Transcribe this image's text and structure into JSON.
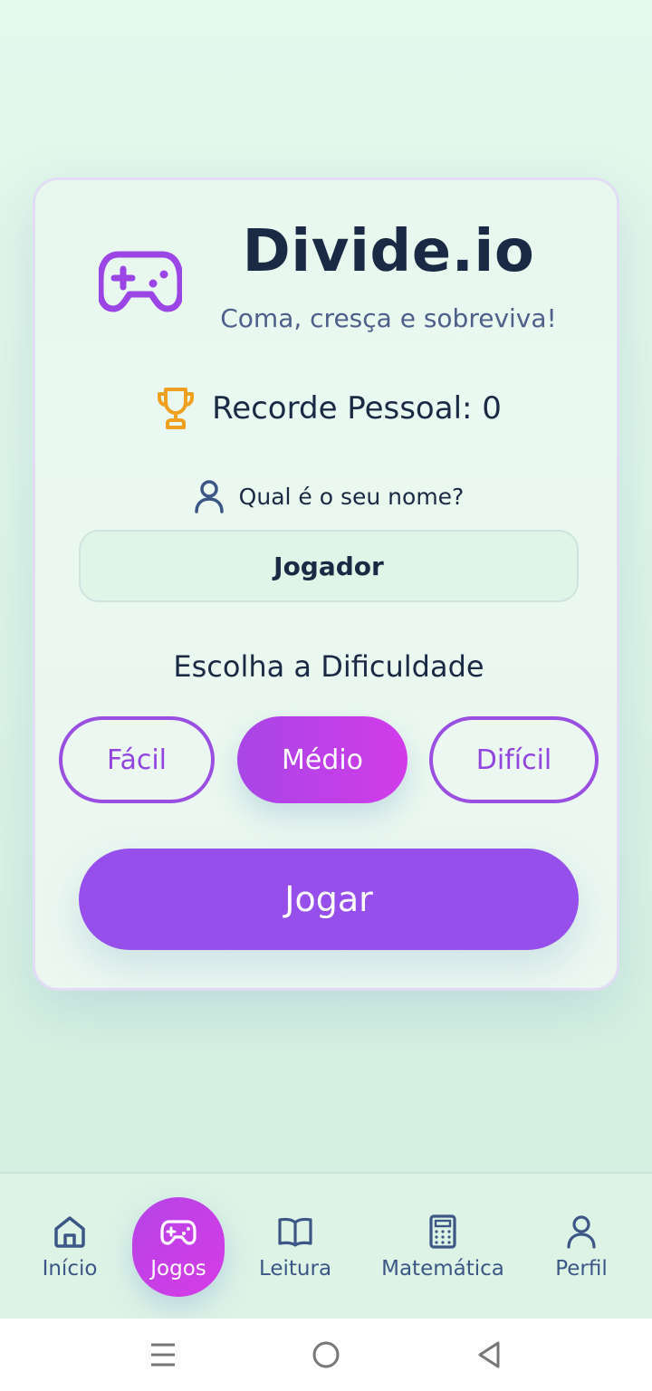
{
  "app": {
    "title": "Divide.io",
    "subtitle": "Coma, cresça e sobreviva!",
    "logo_icon": "gamepad-icon"
  },
  "record": {
    "icon": "trophy-icon",
    "text": "Recorde Pessoal: 0"
  },
  "name": {
    "icon": "user-icon",
    "label": "Qual é o seu nome?",
    "value": "Jogador"
  },
  "difficulty": {
    "title": "Escolha a Dificuldade",
    "options": [
      {
        "label": "Fácil",
        "selected": false
      },
      {
        "label": "Médio",
        "selected": true
      },
      {
        "label": "Difícil",
        "selected": false
      }
    ]
  },
  "play_label": "Jogar",
  "nav": {
    "items": [
      {
        "label": "Início",
        "icon": "home-icon",
        "active": false
      },
      {
        "label": "Jogos",
        "icon": "gamepad-icon",
        "active": true
      },
      {
        "label": "Leitura",
        "icon": "book-icon",
        "active": false
      },
      {
        "label": "Matemática",
        "icon": "calculator-icon",
        "active": false
      },
      {
        "label": "Perfil",
        "icon": "user-icon",
        "active": false
      }
    ]
  },
  "colors": {
    "accent": "#964fea",
    "active_gradient_start": "#a846e6",
    "active_gradient_end": "#d23be9",
    "text_dark": "#1b2a44",
    "trophy": "#f0a020",
    "nav_text": "#3c5785"
  }
}
